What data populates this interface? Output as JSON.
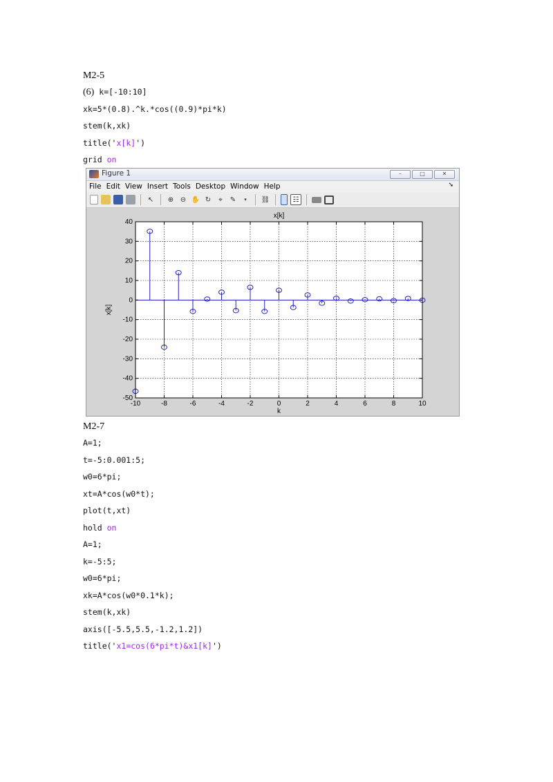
{
  "section1": {
    "heading": "M2-5",
    "label": "(6)",
    "code": [
      "k=[-10:10]",
      "xk=5*(0.8).^k.*cos((0.9)*pi*k)",
      "stem(k,xk)",
      "title('x[k]')",
      "grid on"
    ]
  },
  "figure": {
    "title": "Figure 1",
    "window_buttons": [
      "–",
      "□",
      "✕"
    ],
    "menu": [
      "File",
      "Edit",
      "View",
      "Insert",
      "Tools",
      "Desktop",
      "Window",
      "Help"
    ],
    "toolbar_icons": [
      "new-file-icon",
      "open-folder-icon",
      "save-icon",
      "print-icon",
      "pointer-icon",
      "zoom-in-icon",
      "zoom-out-icon",
      "pan-icon",
      "rotate-icon",
      "data-cursor-icon",
      "brush-icon",
      "link-icon",
      "colorbar-icon",
      "legend-icon",
      "hide-tools-icon",
      "show-tools-icon"
    ]
  },
  "chart_data": {
    "type": "stem",
    "title": "x[k]",
    "xlabel": "k",
    "ylabel": "x[k]",
    "xlim": [
      -10,
      10
    ],
    "ylim": [
      -50,
      40
    ],
    "xticks": [
      -10,
      -8,
      -6,
      -4,
      -2,
      0,
      2,
      4,
      6,
      8,
      10
    ],
    "yticks": [
      40,
      30,
      20,
      10,
      0,
      -10,
      -20,
      -30,
      -40,
      -50
    ],
    "grid": true,
    "x": [
      -10,
      -9,
      -8,
      -7,
      -6,
      -5,
      -4,
      -3,
      -2,
      -1,
      0,
      1,
      2,
      3,
      4,
      5,
      6,
      7,
      8,
      9,
      10
    ],
    "y": [
      -46.6,
      35.1,
      -24.1,
      14.0,
      -5.8,
      0.5,
      4.0,
      -5.4,
      6.5,
      -5.8,
      5.0,
      -3.8,
      2.6,
      -1.6,
      0.9,
      -0.5,
      0.2,
      0.6,
      -0.3,
      0.8,
      -0.1
    ],
    "color": "#1f1fbf"
  },
  "section2": {
    "heading": "M2-7",
    "code": [
      "A=1;",
      "t=-5:0.001:5;",
      "w0=6*pi;",
      "xt=A*cos(w0*t);",
      "plot(t,xt)",
      "hold on",
      "A=1;",
      "k=-5:5;",
      "w0=6*pi;",
      "xk=A*cos(w0*0.1*k);",
      "stem(k,xk)",
      "axis([-5.5,5.5,-1.2,1.2])",
      "title('x1=cos(6*pi*t)&x1[k]')"
    ]
  }
}
